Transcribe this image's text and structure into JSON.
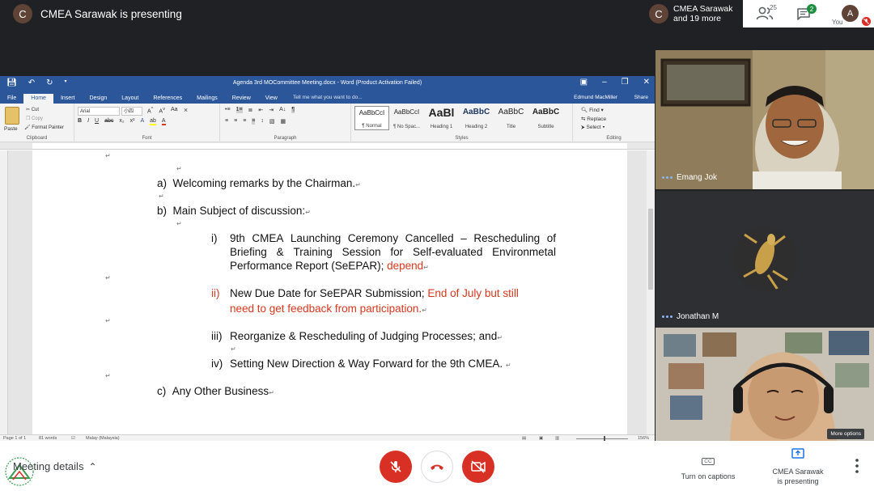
{
  "meet": {
    "presenter_initial": "C",
    "presenting_text": "CMEA Sarawak is presenting",
    "participants_chip_initial": "C",
    "participants_chip_line1": "CMEA Sarawak",
    "participants_chip_line2": "and 19 more",
    "people_count": "25",
    "chat_badge": "2",
    "you_initial": "A",
    "you_label": "You",
    "meeting_details": "Meeting details",
    "captions_icon": "CC",
    "captions_label": "Turn on captions",
    "present_label_1": "CMEA Sarawak",
    "present_label_2": "is presenting",
    "more_options": "More options"
  },
  "tiles": [
    {
      "name": "Emang Jok"
    },
    {
      "name": "Jonathan M"
    }
  ],
  "word": {
    "title": "Agenda 3rd MOCommittee Meeting.docx - Word (Product Activation Failed)",
    "tabs": [
      "File",
      "Home",
      "Insert",
      "Design",
      "Layout",
      "References",
      "Mailings",
      "Review",
      "View"
    ],
    "tell_me": "Tell me what you want to do...",
    "user": "Edmund MacMiller",
    "share": "Share",
    "clipboard": {
      "paste": "Paste",
      "cut": "Cut",
      "copy": "Copy",
      "format_painter": "Format Painter",
      "label": "Clipboard"
    },
    "font": {
      "name": "Arial",
      "size": "小四",
      "label": "Font"
    },
    "paragraph_label": "Paragraph",
    "styles": {
      "label": "Styles",
      "items": [
        {
          "sample": "AaBbCcI",
          "name": "¶ Normal"
        },
        {
          "sample": "AaBbCcI",
          "name": "¶ No Spac..."
        },
        {
          "sample": "AaBl",
          "name": "Heading 1"
        },
        {
          "sample": "AaBbC",
          "name": "Heading 2"
        },
        {
          "sample": "AaBbC",
          "name": "Title"
        },
        {
          "sample": "AaBbC",
          "name": "Subtitle"
        }
      ]
    },
    "editing": {
      "find": "Find",
      "replace": "Replace",
      "select": "Select",
      "label": "Editing"
    },
    "status": {
      "page": "Page 1 of 1",
      "words": "81 words",
      "language": "Malay (Malaysia)",
      "zoom": "156%"
    },
    "doc": {
      "a_label": "a)",
      "a_text": "Welcoming remarks by the Chairman.",
      "b_label": "b)",
      "b_text": "Main Subject of discussion:",
      "i_label": "i)",
      "i_line1_words": [
        "9th",
        "CMEA",
        "Launching",
        "Ceremony",
        "Cancelled",
        "–",
        "Rescheduling",
        "of"
      ],
      "i_line2_words": [
        "Briefing",
        "&",
        "Training",
        "Session",
        "for",
        "Self-evaluated",
        "Environmetal"
      ],
      "i_line3": "Performance Report (SeEPAR);",
      "i_line3_red": "depend",
      "ii_label": "ii)",
      "ii_line1": "New Due Date for SeEPAR Submission;",
      "ii_line1_red": "End of July but still",
      "ii_line2_red": "need to get feedback from participation.",
      "iii_label": "iii)",
      "iii_text": "Reorganize & Rescheduling of Judging Processes; and",
      "iv_label": "iv)",
      "iv_text": "Setting New Direction & Way Forward for the 9th CMEA.",
      "c_label": "c)",
      "c_text": "Any Other Business"
    }
  },
  "colors": {
    "word_blue": "#2b579a",
    "meet_red": "#d93025",
    "doc_red": "#d9381e",
    "meet_dark": "#202124"
  }
}
